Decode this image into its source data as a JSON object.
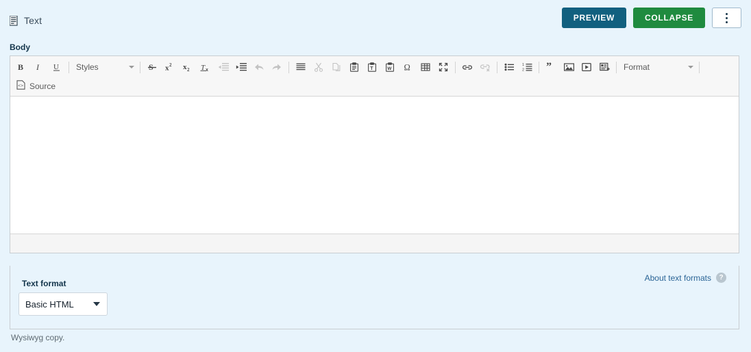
{
  "header": {
    "node_type_label": "Text",
    "node_type_icon": "text-lines-icon",
    "preview_label": "PREVIEW",
    "collapse_label": "COLLAPSE",
    "more_label": "more-actions",
    "colors": {
      "preview_bg": "#11607f",
      "collapse_bg": "#1f8b3f",
      "page_bg": "#e8f4fc"
    }
  },
  "body_field": {
    "label": "Body",
    "description": "Wysiwyg copy.",
    "content": ""
  },
  "toolbar": {
    "row1": [
      {
        "name": "bold-icon",
        "label": "B",
        "enabled": true
      },
      {
        "name": "italic-icon",
        "label": "I",
        "enabled": true
      },
      {
        "name": "underline-icon",
        "label": "U",
        "enabled": true
      },
      {
        "name": "separator",
        "label": "",
        "enabled": false
      },
      {
        "name": "styles-dropdown",
        "label": "Styles",
        "enabled": true
      },
      {
        "name": "separator",
        "label": "",
        "enabled": false
      },
      {
        "name": "strikethrough-icon",
        "label": "S",
        "enabled": true
      },
      {
        "name": "superscript-icon",
        "label": "x2",
        "enabled": true
      },
      {
        "name": "subscript-icon",
        "label": "x2",
        "enabled": true
      },
      {
        "name": "remove-format-icon",
        "label": "Tx",
        "enabled": true
      },
      {
        "name": "outdent-icon",
        "label": "",
        "enabled": false
      },
      {
        "name": "indent-icon",
        "label": "",
        "enabled": true
      },
      {
        "name": "undo-icon",
        "label": "",
        "enabled": false
      },
      {
        "name": "redo-icon",
        "label": "",
        "enabled": false
      },
      {
        "name": "justify-icon",
        "label": "",
        "enabled": true
      },
      {
        "name": "cut-icon",
        "label": "",
        "enabled": false
      },
      {
        "name": "copy-icon",
        "label": "",
        "enabled": false
      },
      {
        "name": "paste-icon",
        "label": "",
        "enabled": true
      },
      {
        "name": "paste-as-text-icon",
        "label": "",
        "enabled": true
      },
      {
        "name": "paste-from-word-icon",
        "label": "",
        "enabled": true
      },
      {
        "name": "special-character-icon",
        "label": "Ω",
        "enabled": true
      },
      {
        "name": "table-icon",
        "label": "",
        "enabled": true
      },
      {
        "name": "maximize-icon",
        "label": "",
        "enabled": true
      },
      {
        "name": "link-icon",
        "label": "",
        "enabled": true
      },
      {
        "name": "unlink-icon",
        "label": "",
        "enabled": false
      },
      {
        "name": "bulleted-list-icon",
        "label": "",
        "enabled": true
      },
      {
        "name": "numbered-list-icon",
        "label": "",
        "enabled": true
      },
      {
        "name": "blockquote-icon",
        "label": "",
        "enabled": true
      },
      {
        "name": "image-icon",
        "label": "",
        "enabled": true
      },
      {
        "name": "media-icon",
        "label": "",
        "enabled": true
      },
      {
        "name": "entity-embed-icon",
        "label": "",
        "enabled": true
      },
      {
        "name": "format-dropdown",
        "label": "Format",
        "enabled": true
      }
    ],
    "styles_label": "Styles",
    "format_label": "Format",
    "source_label": "Source",
    "source_icon": "source-code-icon"
  },
  "text_format": {
    "about_link": "About text formats",
    "help_icon": "help-question-icon",
    "label": "Text format",
    "selected": "Basic HTML",
    "options": [
      "Basic HTML"
    ]
  }
}
